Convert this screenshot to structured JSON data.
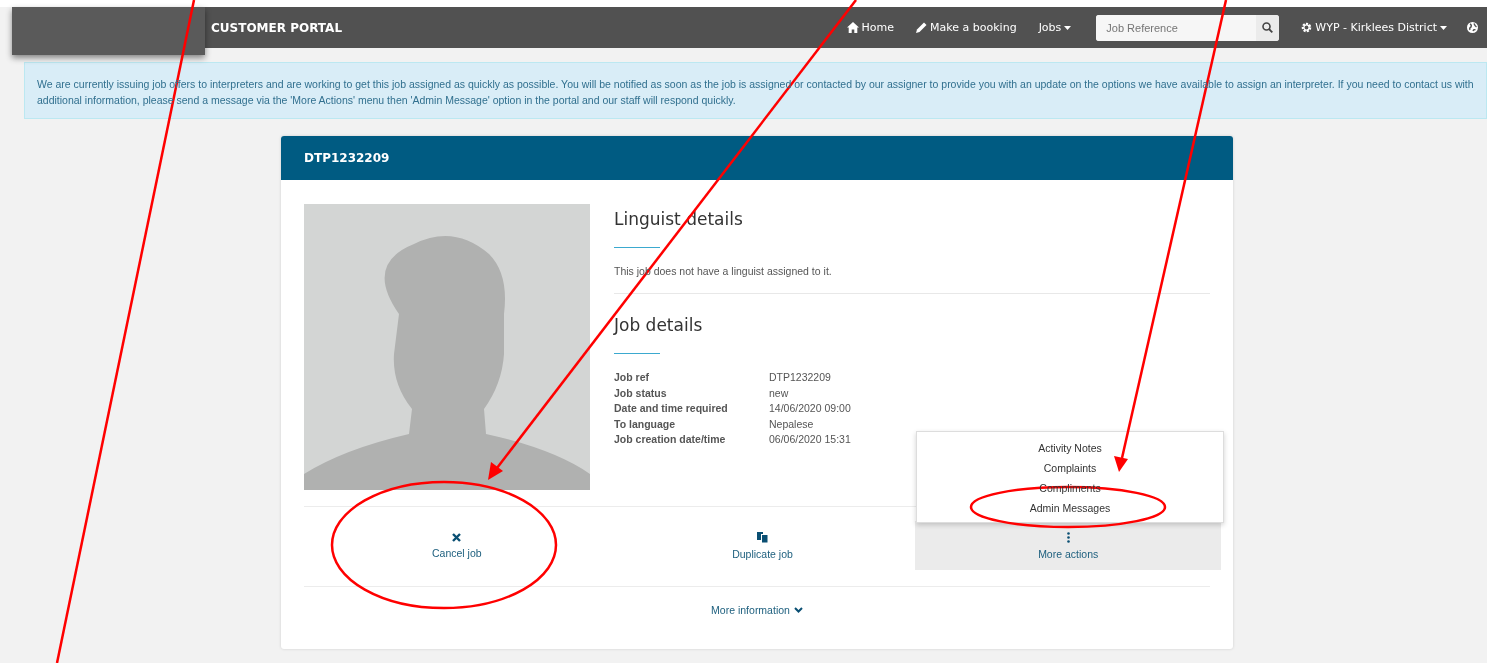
{
  "navbar": {
    "brand": "CUSTOMER PORTAL",
    "links": [
      {
        "label": "Home",
        "kind": "home",
        "dropdown": false
      },
      {
        "label": "Make a booking",
        "kind": "edit",
        "dropdown": false
      },
      {
        "label": "Jobs",
        "kind": "plain",
        "dropdown": true
      }
    ],
    "search": {
      "placeholder": "Job Reference"
    },
    "account": {
      "label": "WYP - Kirklees District",
      "dropdown": true
    }
  },
  "alert": "We are currently issuing job offers to interpreters and are working to get this job assigned as quickly as possible. You will be notified as soon as the job is assigned or contacted by our assigner to provide you with an update on the options we have available to assign an interpreter. If you need to contact us with additional information, please send a message via the 'More Actions' menu then 'Admin Message' option in the portal and our staff will respond quickly.",
  "card": {
    "title": "DTP1232209",
    "linguist": {
      "heading": "Linguist details",
      "message": "This job does not have a linguist assigned to it."
    },
    "job": {
      "heading": "Job details",
      "fields": [
        {
          "label": "Job ref",
          "value": "DTP1232209"
        },
        {
          "label": "Job status",
          "value": "new"
        },
        {
          "label": "Date and time required",
          "value": "14/06/2020 09:00"
        },
        {
          "label": "To language",
          "value": "Nepalese"
        },
        {
          "label": "Job creation date/time",
          "value": "06/06/2020 15:31"
        }
      ]
    },
    "actions": [
      {
        "label": "Cancel job",
        "kind": "cancel",
        "open": false
      },
      {
        "label": "Duplicate job",
        "kind": "duplicate",
        "open": false
      },
      {
        "label": "More actions",
        "kind": "more",
        "open": true
      }
    ],
    "menu": [
      "Activity Notes",
      "Complaints",
      "Compliments",
      "Admin Messages"
    ],
    "more_information": "More information"
  }
}
